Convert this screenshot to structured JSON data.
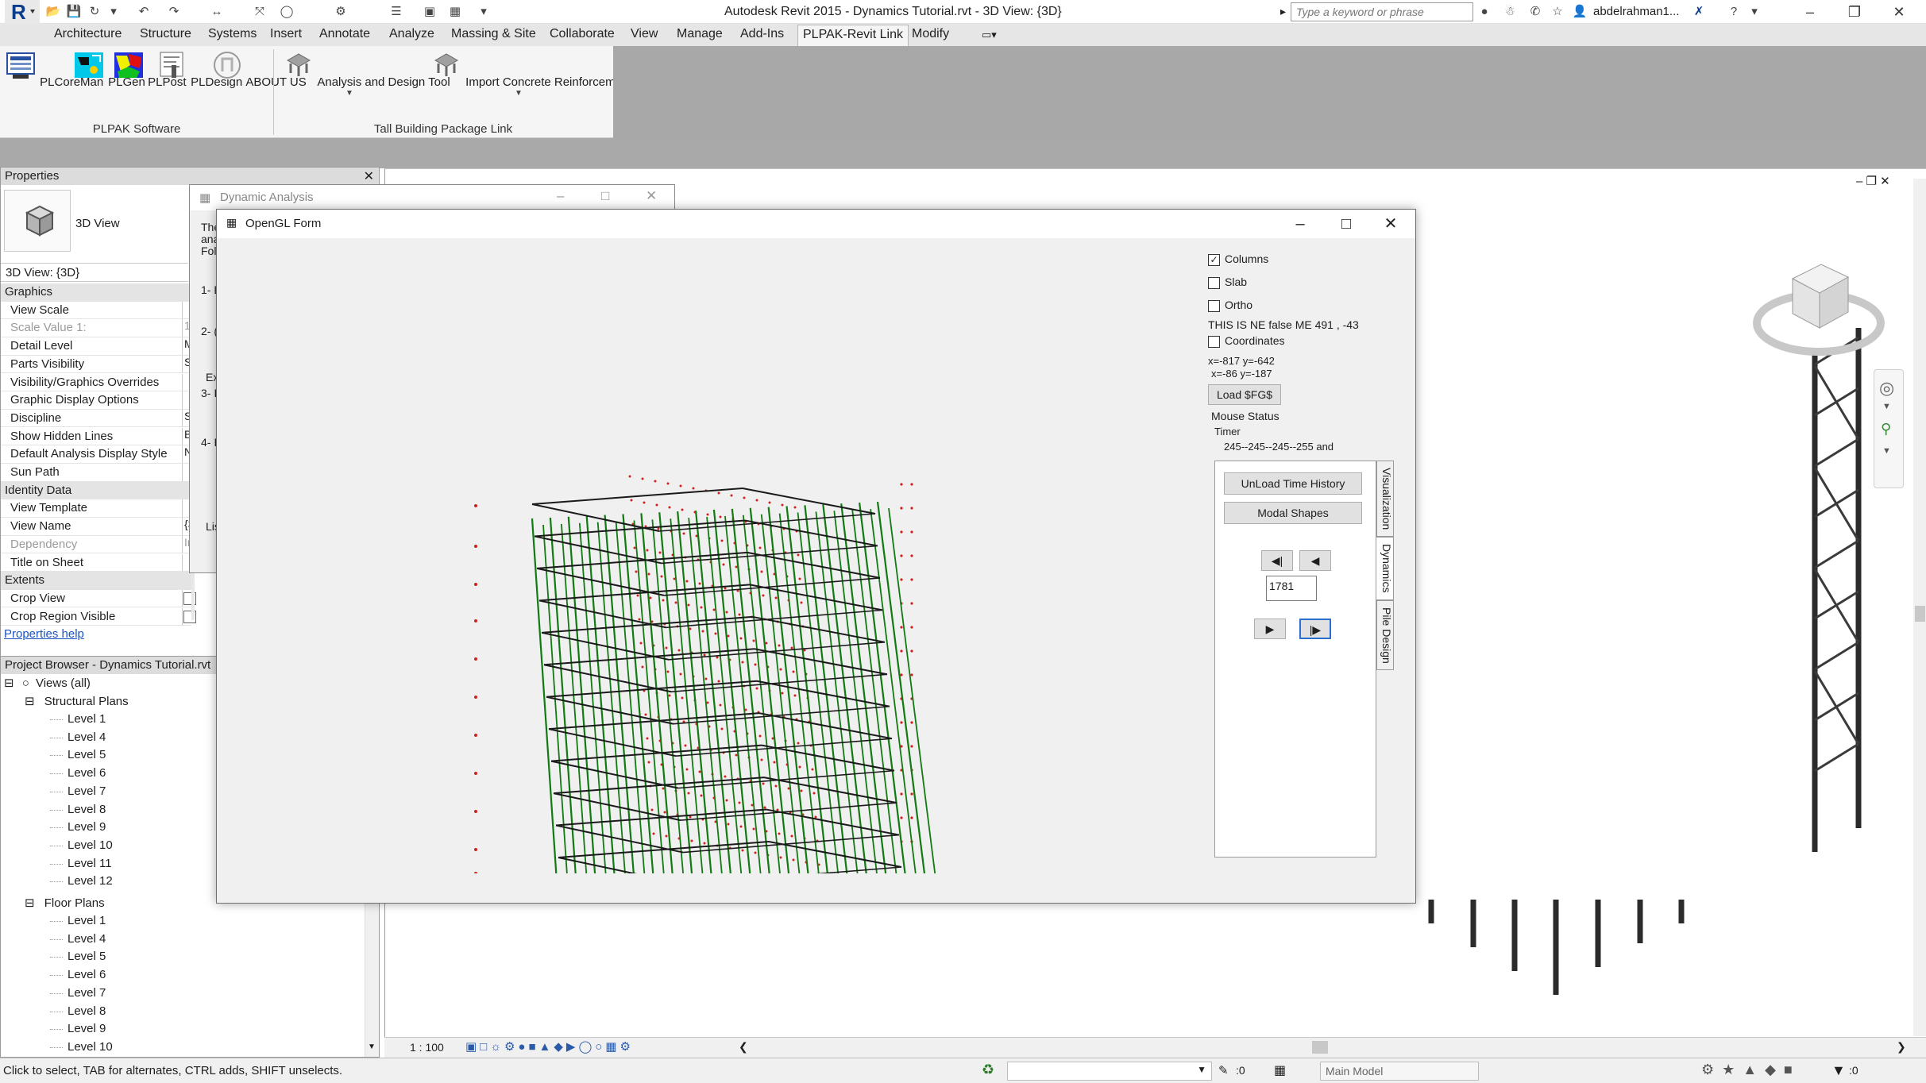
{
  "app": {
    "title": "Autodesk Revit 2015 -    Dynamics Tutorial.rvt - 3D View: {3D}",
    "search_placeholder": "Type a keyword or phrase",
    "user": "abdelrahman1..."
  },
  "menu_tabs": [
    "Architecture",
    "Structure",
    "Systems",
    "Insert",
    "Annotate",
    "Analyze",
    "Massing & Site",
    "Collaborate",
    "View",
    "Manage",
    "Add-Ins",
    "PLPAK-Revit Link",
    "Modify"
  ],
  "ribbon": {
    "buttons": [
      "PLCoreMan",
      "PLGen",
      "PLPost",
      "PLDesign",
      "ABOUT US",
      "Analysis and Design Tool",
      "Import Concrete Reinforcement"
    ],
    "panels": [
      "PLPAK Software",
      "Tall Building Package Link"
    ]
  },
  "properties": {
    "header": "Properties",
    "type_name": "3D View",
    "instance": "3D View: {3D}",
    "rows": [
      {
        "label": "Graphics",
        "cat": true,
        "val": ""
      },
      {
        "label": "View Scale",
        "val": ""
      },
      {
        "label": "Scale Value    1:",
        "val": "1",
        "grey": true
      },
      {
        "label": "Detail Level",
        "val": "M"
      },
      {
        "label": "Parts Visibility",
        "val": "S"
      },
      {
        "label": "Visibility/Graphics Overrides",
        "val": ""
      },
      {
        "label": "Graphic Display Options",
        "val": ""
      },
      {
        "label": "Discipline",
        "val": "S"
      },
      {
        "label": "Show Hidden Lines",
        "val": "B"
      },
      {
        "label": "Default Analysis Display Style",
        "val": "N"
      },
      {
        "label": "Sun Path",
        "val": ""
      },
      {
        "label": "Identity Data",
        "cat": true,
        "val": ""
      },
      {
        "label": "View Template",
        "val": ""
      },
      {
        "label": "View Name",
        "val": "{3"
      },
      {
        "label": "Dependency",
        "val": "In",
        "grey": true
      },
      {
        "label": "Title on Sheet",
        "val": ""
      },
      {
        "label": "Extents",
        "cat": true,
        "val": ""
      },
      {
        "label": "Crop View",
        "val": ""
      },
      {
        "label": "Crop Region Visible",
        "val": ""
      }
    ],
    "help": "Properties help"
  },
  "browser": {
    "header": "Project Browser - Dynamics Tutorial.rvt",
    "views_all": "Views (all)",
    "structural_plans": "Structural Plans",
    "structural_levels": [
      "Level 1",
      "Level 4",
      "Level 5",
      "Level 6",
      "Level 7",
      "Level 8",
      "Level 9",
      "Level 10",
      "Level 11",
      "Level 12"
    ],
    "floor_plans": "Floor Plans",
    "floor_levels": [
      "Level 1",
      "Level 4",
      "Level 5",
      "Level 6",
      "Level 7",
      "Level 8",
      "Level 9",
      "Level 10"
    ]
  },
  "dynamic_window": {
    "title": "Dynamic Analysis",
    "fragments": [
      "The",
      "ana",
      "Fol",
      "1- E",
      "2- (",
      "Ex",
      "3- I",
      "4- I",
      "Lis"
    ]
  },
  "gl_form": {
    "title": "OpenGL Form",
    "columns": "Columns",
    "slab": "Slab",
    "ortho": "Ortho",
    "ne_status": "THIS IS NE false   ME  491 , -43",
    "coordinates": "Coordinates",
    "coord1": "x=-817 y=-642",
    "coord2": "x=-86 y=-187",
    "load_btn": "Load $FG$",
    "mouse_status": "Mouse Status",
    "timer": "Timer",
    "timer_values": "245--245--245--255 and",
    "unload_btn": "UnLoad Time History",
    "modal_btn": "Modal Shapes",
    "frame_value": "1781",
    "tabs": [
      "Visualization",
      "Dynamics",
      "Pile Design"
    ]
  },
  "view_control": {
    "scale": "1 : 100"
  },
  "status": {
    "message": "Click to select, TAB for alternates, CTRL adds, SHIFT unselects.",
    "zero": ":0",
    "model": "Main Model",
    "filter_count": ":0"
  },
  "colors": {
    "column": "#127a12",
    "slab": "#1a1a1a",
    "support": "#e01010",
    "mass_point": "#d02020"
  }
}
